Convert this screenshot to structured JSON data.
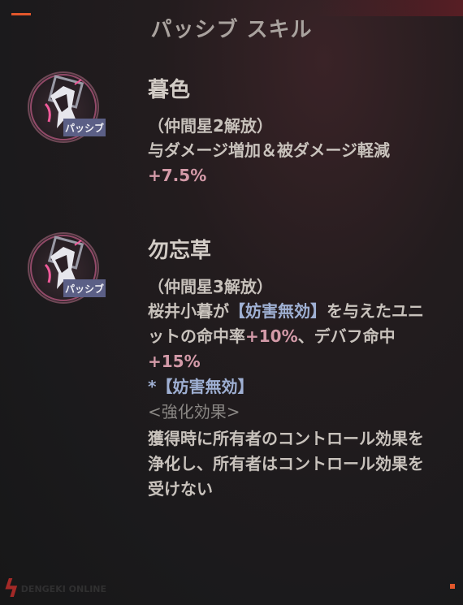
{
  "panel": {
    "title": "パッシブ スキル"
  },
  "skills": [
    {
      "icon": "skill-emblem-icon",
      "badge": "パッシブ",
      "name": "暮色",
      "condition": "（仲間星2解放）",
      "desc_parts": [
        "与ダメージ増加＆被ダメージ軽減",
        "+7.5%"
      ]
    },
    {
      "icon": "skill-emblem-icon",
      "badge": "パッシブ",
      "name": "勿忘草",
      "condition": "（仲間星3解放）",
      "desc_parts": [
        "桜井小暮が",
        "【妨害無効】",
        "を与えたユニットの命中率",
        "+10%",
        "、デバフ命中",
        "+15%"
      ],
      "note": "*【妨害無効】",
      "sub_heading": "<強化効果>",
      "sub_desc": "獲得時に所有者のコントロール効果を浄化し、所有者はコントロール効果を受けない"
    }
  ],
  "colors": {
    "accent": "#e2572b",
    "badge": "#5b5f86",
    "number_highlight": "#d39aa8",
    "keyword_highlight": "#9fb0d3"
  },
  "watermark": {
    "text": "DENGEKI ONLINE"
  }
}
